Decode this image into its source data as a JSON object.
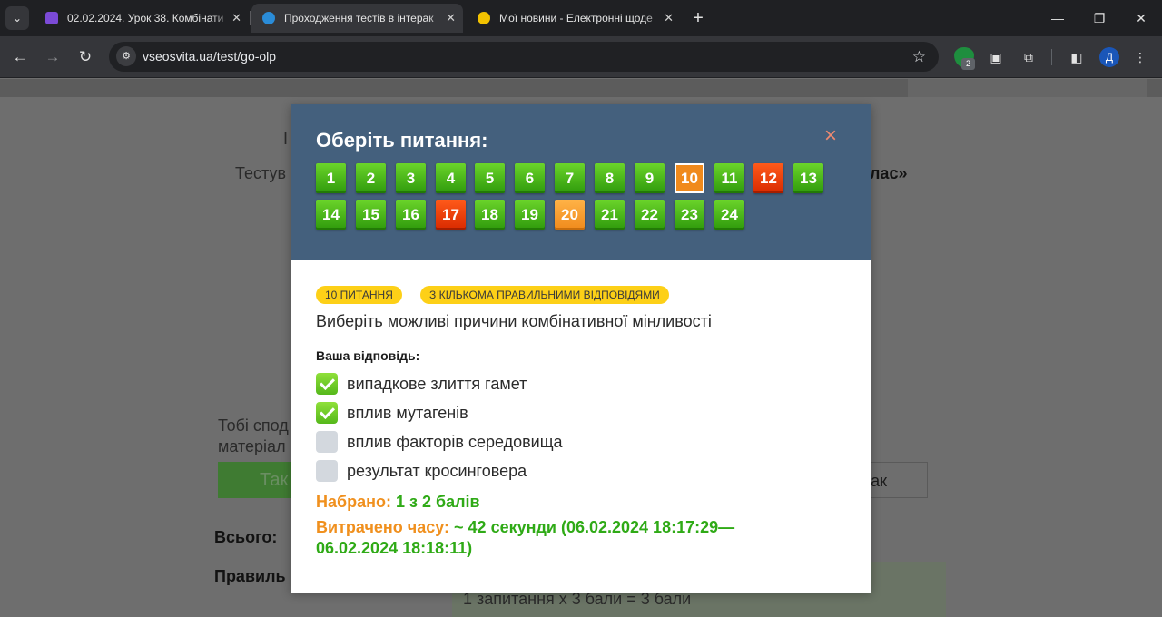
{
  "browser": {
    "tabs": [
      {
        "title": "02.02.2024. Урок 38. Комбінати",
        "active": false,
        "favicon_color": "#7b4ad6"
      },
      {
        "title": "Проходження тестів в інтерак",
        "active": true,
        "favicon_color": "#2a8cd8"
      },
      {
        "title": "Мої новини - Електронні щоде",
        "active": false,
        "favicon_color": "#f2c200"
      }
    ],
    "url": "vseosvita.ua/test/go-olp",
    "extension_badge": "2",
    "profile_initial": "Д"
  },
  "background_page": {
    "fragment_i": "І",
    "testing_prefix": "Тестув",
    "class_suffix": "лас»",
    "feedback_line1": "Тобі спод",
    "feedback_line2": "матеріал",
    "btn_yes_partial": "Так",
    "btn_no_partial": "ак",
    "total_label": "Всього:",
    "correct_label": "Правиль",
    "score_line": "1 запитання x 3 бали = 3 бали"
  },
  "modal": {
    "title": "Оберіть питання:",
    "close_icon": "×",
    "questions": [
      {
        "num": "1",
        "status": "green"
      },
      {
        "num": "2",
        "status": "green"
      },
      {
        "num": "3",
        "status": "green"
      },
      {
        "num": "4",
        "status": "green"
      },
      {
        "num": "5",
        "status": "green"
      },
      {
        "num": "6",
        "status": "green"
      },
      {
        "num": "7",
        "status": "green"
      },
      {
        "num": "8",
        "status": "green"
      },
      {
        "num": "9",
        "status": "green"
      },
      {
        "num": "10",
        "status": "current"
      },
      {
        "num": "11",
        "status": "green"
      },
      {
        "num": "12",
        "status": "red"
      },
      {
        "num": "13",
        "status": "green"
      },
      {
        "num": "14",
        "status": "green"
      },
      {
        "num": "15",
        "status": "green"
      },
      {
        "num": "16",
        "status": "green"
      },
      {
        "num": "17",
        "status": "red"
      },
      {
        "num": "18",
        "status": "green"
      },
      {
        "num": "19",
        "status": "green"
      },
      {
        "num": "20",
        "status": "orange"
      },
      {
        "num": "21",
        "status": "green"
      },
      {
        "num": "22",
        "status": "green"
      },
      {
        "num": "23",
        "status": "green"
      },
      {
        "num": "24",
        "status": "green"
      }
    ],
    "badge_number": "10 ПИТАННЯ",
    "badge_type": "З КІЛЬКОМА ПРАВИЛЬНИМИ ВІДПОВІДЯМИ",
    "question_text": "Виберіть можливі причини комбінативної мінливості",
    "answer_label": "Ваша відповідь:",
    "options": [
      {
        "text": "випадкове злиття гамет",
        "checked": true
      },
      {
        "text": "вплив мутагенів",
        "checked": true
      },
      {
        "text": "вплив факторів середовища",
        "checked": false
      },
      {
        "text": "результат кросинговера",
        "checked": false
      }
    ],
    "score_label": "Набрано:",
    "score_value": "1 з 2 балів",
    "time_label": "Витрачено часу:",
    "time_value_line1": "~ 42 секунди (06.02.2024 18:17:29—",
    "time_value_line2": "06.02.2024 18:18:11)"
  }
}
